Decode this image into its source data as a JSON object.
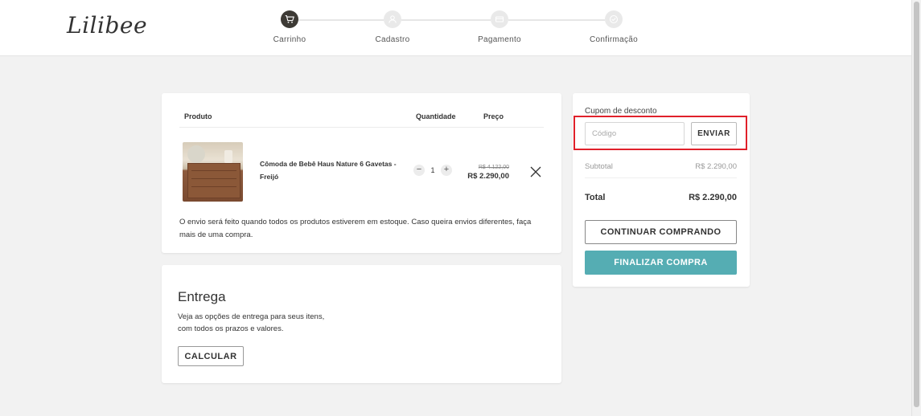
{
  "header": {
    "logo_text": "Lilibee",
    "steps": [
      {
        "label": "Carrinho",
        "icon": "cart-icon",
        "active": true
      },
      {
        "label": "Cadastro",
        "icon": "user-icon",
        "active": false
      },
      {
        "label": "Pagamento",
        "icon": "payment-icon",
        "active": false
      },
      {
        "label": "Confirmação",
        "icon": "check-icon",
        "active": false
      }
    ]
  },
  "cart": {
    "columns": {
      "product": "Produto",
      "quantity": "Quantidade",
      "price": "Preço"
    },
    "items": [
      {
        "name": "Cômoda de Bebê Haus Nature 6 Gavetas - Freijó",
        "quantity": "1",
        "price_old": "R$ 4.122,00",
        "price_new": "R$ 2.290,00"
      }
    ],
    "shipping_note": "O envio será feito quando todos os produtos estiverem em estoque. Caso queira envios diferentes, faça mais de uma compra."
  },
  "delivery": {
    "title": "Entrega",
    "description_line1": "Veja as opções de entrega para seus itens,",
    "description_line2": "com todos os prazos e valores.",
    "calculate_label": "CALCULAR"
  },
  "summary": {
    "coupon_label": "Cupom de desconto",
    "coupon_placeholder": "Código",
    "coupon_value": "",
    "send_label": "ENVIAR",
    "subtotal_label": "Subtotal",
    "subtotal_value": "R$ 2.290,00",
    "total_label": "Total",
    "total_value": "R$ 2.290,00",
    "continue_label": "CONTINUAR COMPRANDO",
    "checkout_label": "FINALIZAR COMPRA"
  },
  "colors": {
    "accent": "#55adb3",
    "active_step": "#3d3a35",
    "highlight": "#e0202a"
  }
}
